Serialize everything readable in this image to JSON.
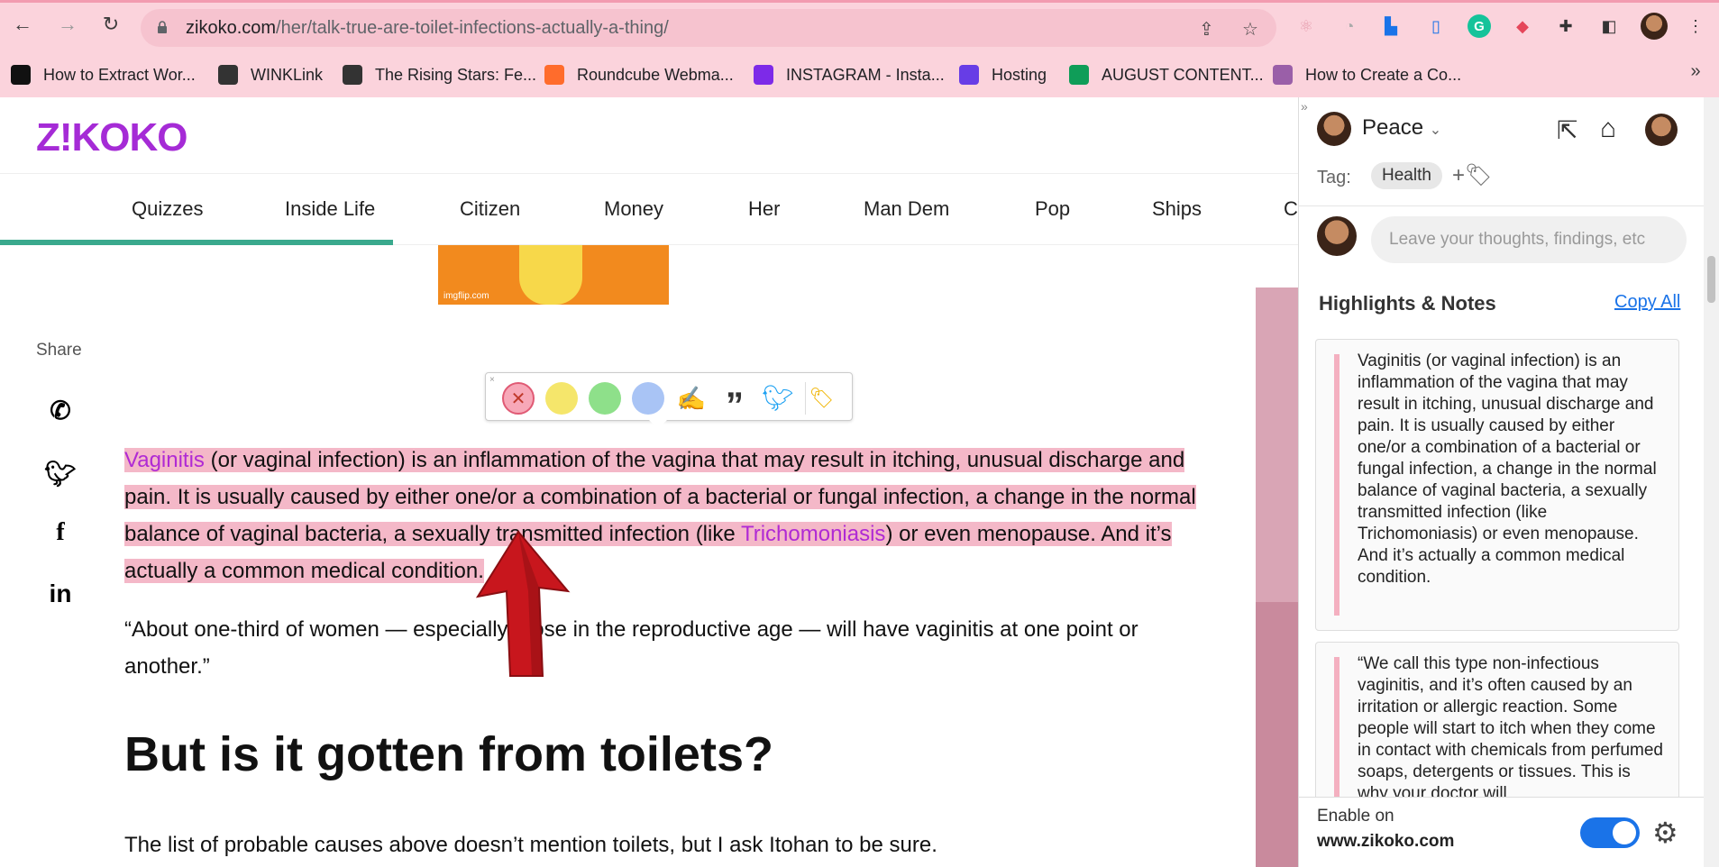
{
  "browser": {
    "url_host": "zikoko.com",
    "url_path": "/her/talk-true-are-toilet-infections-actually-a-thing/",
    "bookmarks": [
      {
        "label": "How to Extract Wor...",
        "icon": "medium-icon",
        "color": "#111111"
      },
      {
        "label": "WINKLink",
        "icon": "globe-icon",
        "color": "#333333"
      },
      {
        "label": "The Rising Stars: Fe...",
        "icon": "globe-icon",
        "color": "#333333"
      },
      {
        "label": "Roundcube Webma...",
        "icon": "cpanel-icon",
        "color": "#ff6c2c"
      },
      {
        "label": "INSTAGRAM - Insta...",
        "icon": "canva-icon",
        "color": "#7d2ae8"
      },
      {
        "label": "Hosting",
        "icon": "hostinger-icon",
        "color": "#673de6"
      },
      {
        "label": "AUGUST CONTENT...",
        "icon": "sheets-icon",
        "color": "#0f9d58"
      },
      {
        "label": "How to Create a Co...",
        "icon": "wp-icon",
        "color": "#9a5fa8"
      }
    ]
  },
  "site": {
    "logo": "Z!KOKO",
    "nav": [
      "Quizzes",
      "Inside Life",
      "Citizen",
      "Money",
      "Her",
      "Man Dem",
      "Pop",
      "Ships",
      "C"
    ],
    "image_caption": "imgflip.com",
    "share_label": "Share",
    "para1_parts": [
      "Vaginitis",
      " (or vaginal infection) is an inflammation of the vagina that may result in itching, unusual discharge and pain. It is usually caused by either one/or a combination of a bacterial or fungal infection, a change in the normal balance of vaginal bacteria, a sexually transmitted infection (like ",
      "Trichomoniasis",
      ") or even menopause. And it’s actually a common medical condition."
    ],
    "para2": "“About one-third of women — especially those in the reproductive age — will have vaginitis at one point or another.”",
    "heading": "But is it gotten from toilets?",
    "para3": "The list of probable causes above doesn’t mention toilets, but I ask Itohan to be sure."
  },
  "toolbar": {
    "colors": [
      "#f7a8b8",
      "#f5e66b",
      "#8ee08a",
      "#a9c4f5"
    ]
  },
  "panel": {
    "user": "Peace",
    "tag_label": "Tag:",
    "tag": "Health",
    "comment_placeholder": "Leave your thoughts, findings, etc",
    "title": "Highlights & Notes",
    "copy_all": "Copy All",
    "notes": [
      "Vaginitis (or vaginal infection) is an inflammation of the vagina that may result in itching, unusual discharge and pain. It is usually caused by either one/or a combination of a bacterial or fungal infection, a change in the normal balance of vaginal bacteria, a sexually transmitted infection (like Trichomoniasis) or even menopause. And it’s actually a common medical condition.",
      "“We call this type non-infectious vaginitis, and it’s often caused by an irritation or allergic reaction. Some people will start to itch when they come in contact with chemicals from perfumed soaps, detergents or tissues. This is why your doctor will"
    ],
    "enable_label": "Enable on",
    "enable_domain": "www.zikoko.com"
  }
}
